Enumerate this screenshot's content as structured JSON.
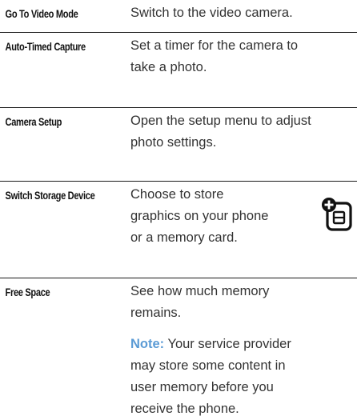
{
  "rows": [
    {
      "option": "Go To Video Mode",
      "description": "Switch to the video camera."
    },
    {
      "option": "Auto-Timed Capture",
      "description_lines": [
        "Set a timer for the camera to",
        "take a photo."
      ]
    },
    {
      "option": "Camera Setup",
      "description_lines": [
        "Open the setup menu to adjust",
        "photo settings."
      ]
    },
    {
      "option": "Switch Storage Device",
      "description_lines": [
        "Choose to store",
        "graphics on your phone",
        "or a memory card."
      ],
      "icon": "memory-card-feature-icon"
    },
    {
      "option": "Free Space",
      "description_lines": [
        "See how much memory",
        "remains."
      ],
      "note_label": "Note:",
      "note_lines": [
        " Your service provider",
        "may store some content in",
        "user memory before you",
        "receive the phone."
      ]
    }
  ]
}
